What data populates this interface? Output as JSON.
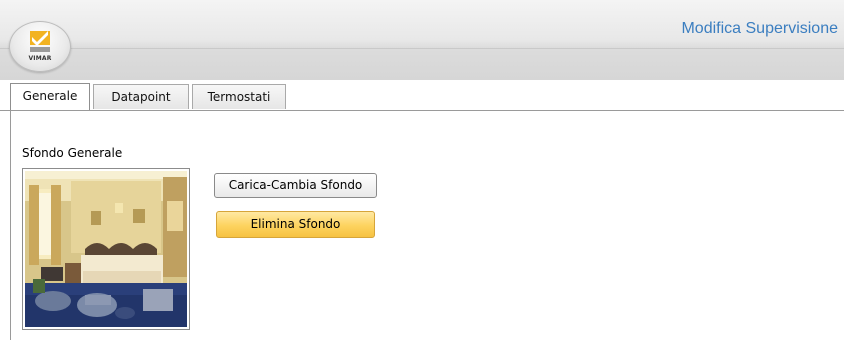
{
  "header": {
    "logo_text": "VIMAR",
    "title": "Modifica Supervisione"
  },
  "tabs": [
    {
      "label": "Generale",
      "active": true
    },
    {
      "label": "Datapoint",
      "active": false
    },
    {
      "label": "Termostati",
      "active": false
    }
  ],
  "content": {
    "section_label": "Sfondo Generale",
    "buttons": {
      "upload_label": "Carica-Cambia Sfondo",
      "delete_label": "Elimina Sfondo"
    }
  },
  "colors": {
    "title": "#3b7ec0",
    "delete_button": "#fdd35f"
  },
  "icons": {
    "logo": "vimar-logo-icon"
  }
}
